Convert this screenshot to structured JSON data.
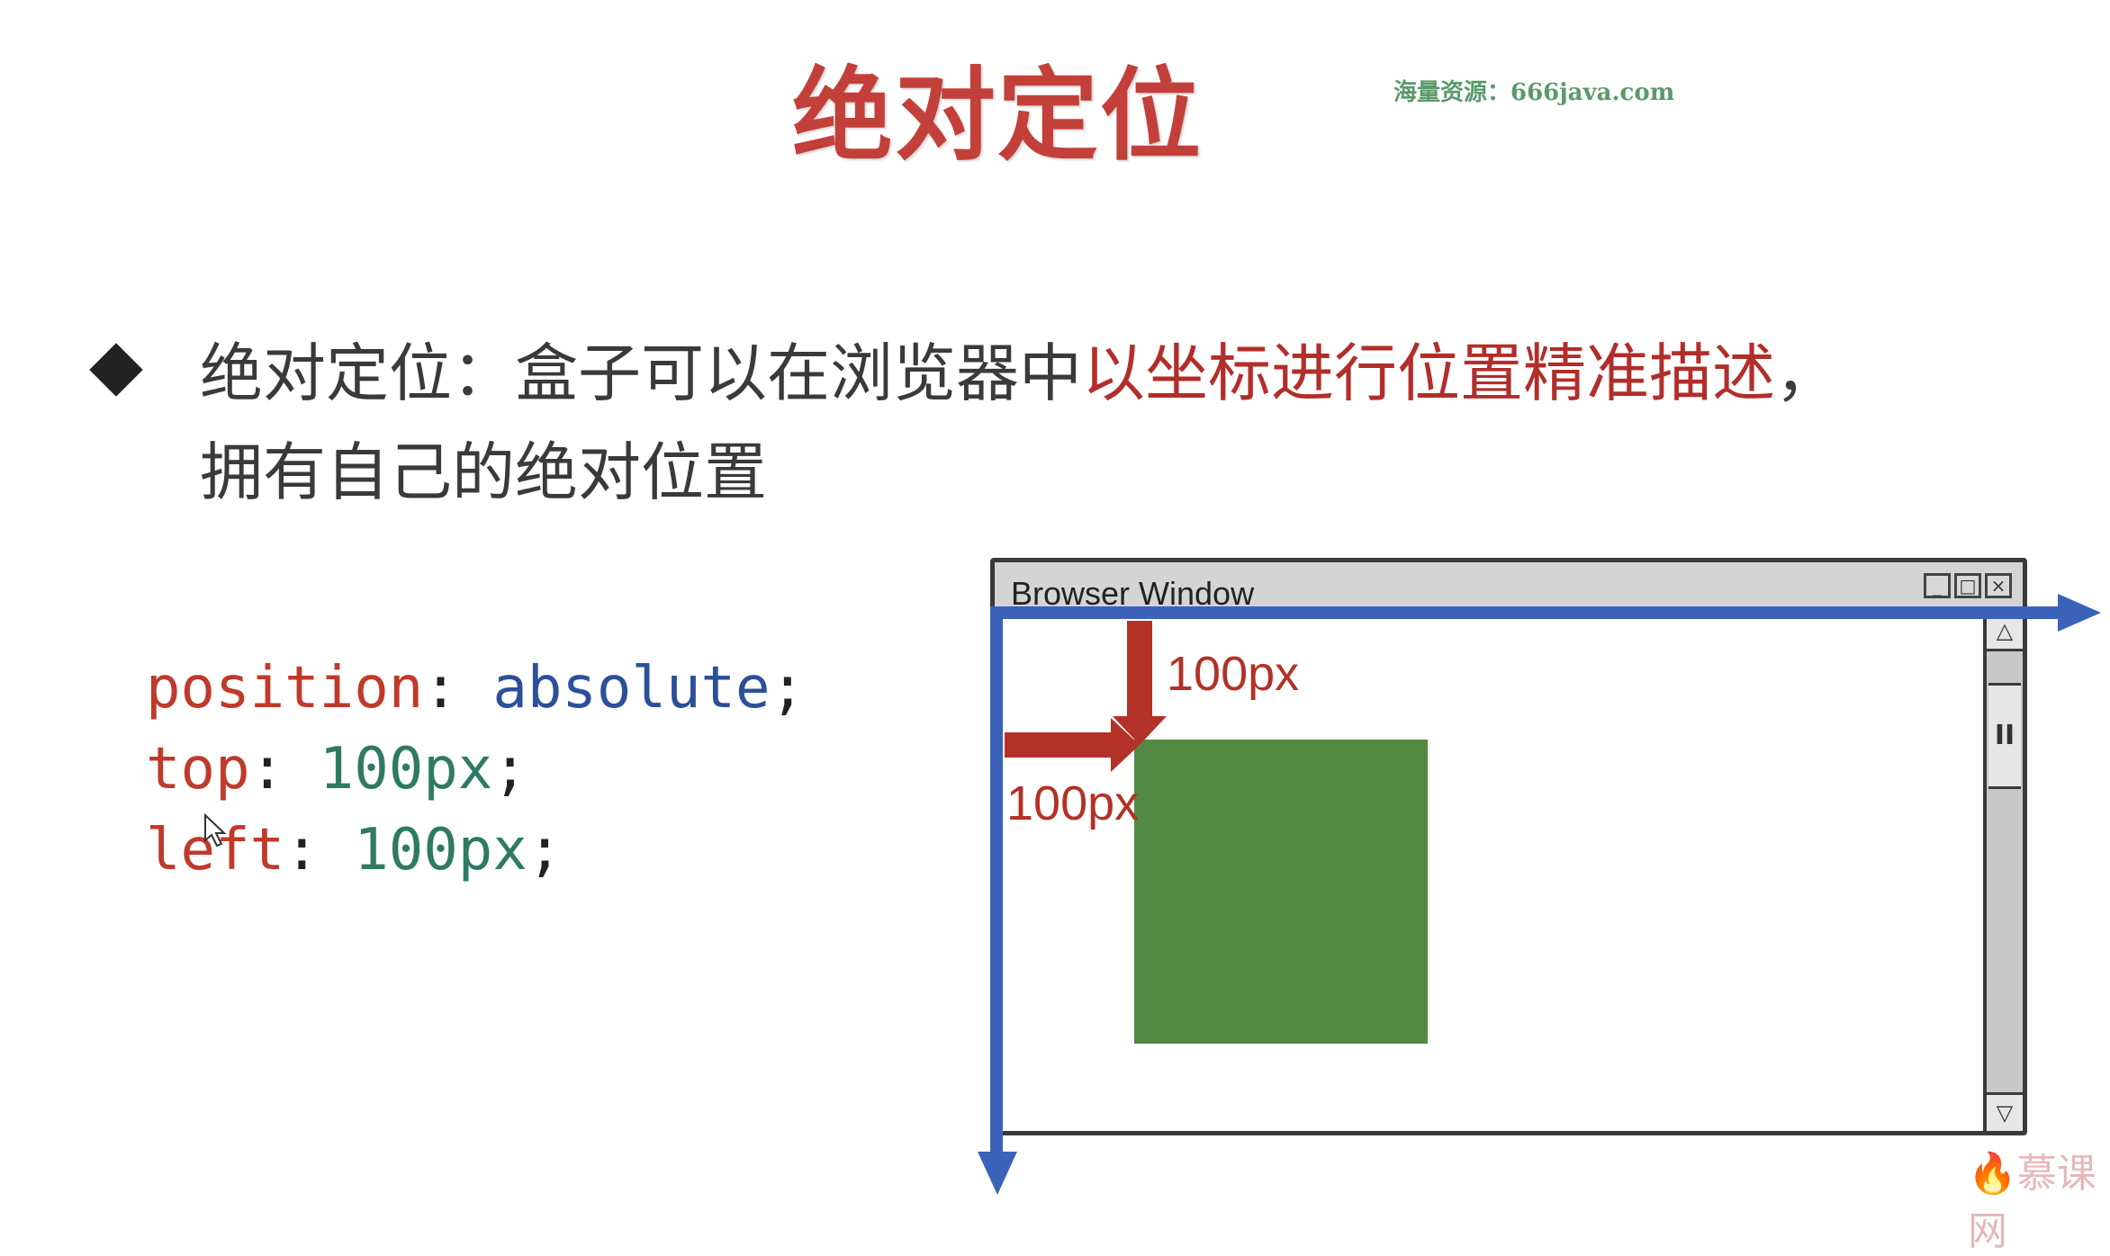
{
  "slide": {
    "title": "绝对定位",
    "watermark": "海量资源：666java.com",
    "bullet": {
      "prefix": "绝对定位：盒子可以在浏览器中",
      "highlight": "以坐标进行位置精准描述",
      "suffix": "，",
      "line2": "拥有自己的绝对位置"
    },
    "code": {
      "line1": {
        "prop": "position",
        "value": "absolute"
      },
      "line2": {
        "prop": "top",
        "value": "100px"
      },
      "line3": {
        "prop": "left",
        "value": "100px"
      }
    }
  },
  "diagram": {
    "window_title": "Browser Window",
    "controls": [
      "_",
      "□",
      "×"
    ],
    "top_label": "100px",
    "left_label": "100px",
    "scroll_up_glyph": "△",
    "scroll_down_glyph": "▽",
    "scroll_thumb_glyph": "II",
    "colors": {
      "axis": "#3a62b8",
      "offset_arrow": "#b33126",
      "box": "#538a41"
    }
  },
  "logo": {
    "text": "慕课网"
  }
}
